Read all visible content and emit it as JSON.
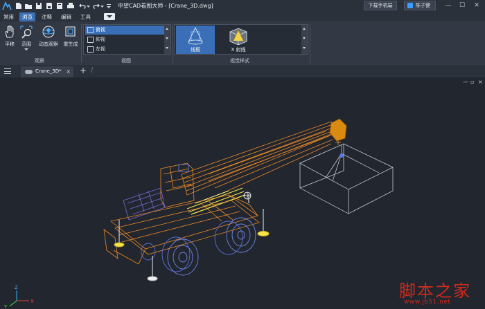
{
  "window": {
    "title": "中望CAD看图大师 - [Crane_3D.dwg]",
    "download_button": "下载手机端",
    "user_name": "陈子健",
    "controls": [
      "—",
      "☐",
      "✕"
    ]
  },
  "menu": {
    "tabs": [
      "常用",
      "浏览",
      "注释",
      "编辑",
      "工具"
    ],
    "active_tab": "浏览"
  },
  "ribbon": {
    "observe_group": {
      "label": "观察",
      "buttons": [
        "平移",
        "范围",
        "动态观察",
        "重生成"
      ]
    },
    "view_group": {
      "label": "视图",
      "items": [
        "俯视",
        "仰视",
        "左视"
      ],
      "selected": "俯视"
    },
    "style_group": {
      "label": "视觉样式",
      "items": [
        "线框",
        "X 射线"
      ],
      "selected": "线框"
    }
  },
  "document": {
    "tab_name": "Crane_3D*",
    "viewport_controls": [
      "—",
      "▫",
      "×"
    ]
  },
  "ucs": {
    "x": "X",
    "y": "Y",
    "z": "Z"
  },
  "watermark": {
    "brand": "脚本之家",
    "url": "www.jb51.net"
  },
  "colors": {
    "accent": "#3a6fb8",
    "crane_orange": "#f08a24",
    "crane_yellow": "#f5e44a",
    "crane_purple": "#7a6bd6",
    "crane_blue": "#6f86e6",
    "wire_white": "#d9dde3"
  }
}
